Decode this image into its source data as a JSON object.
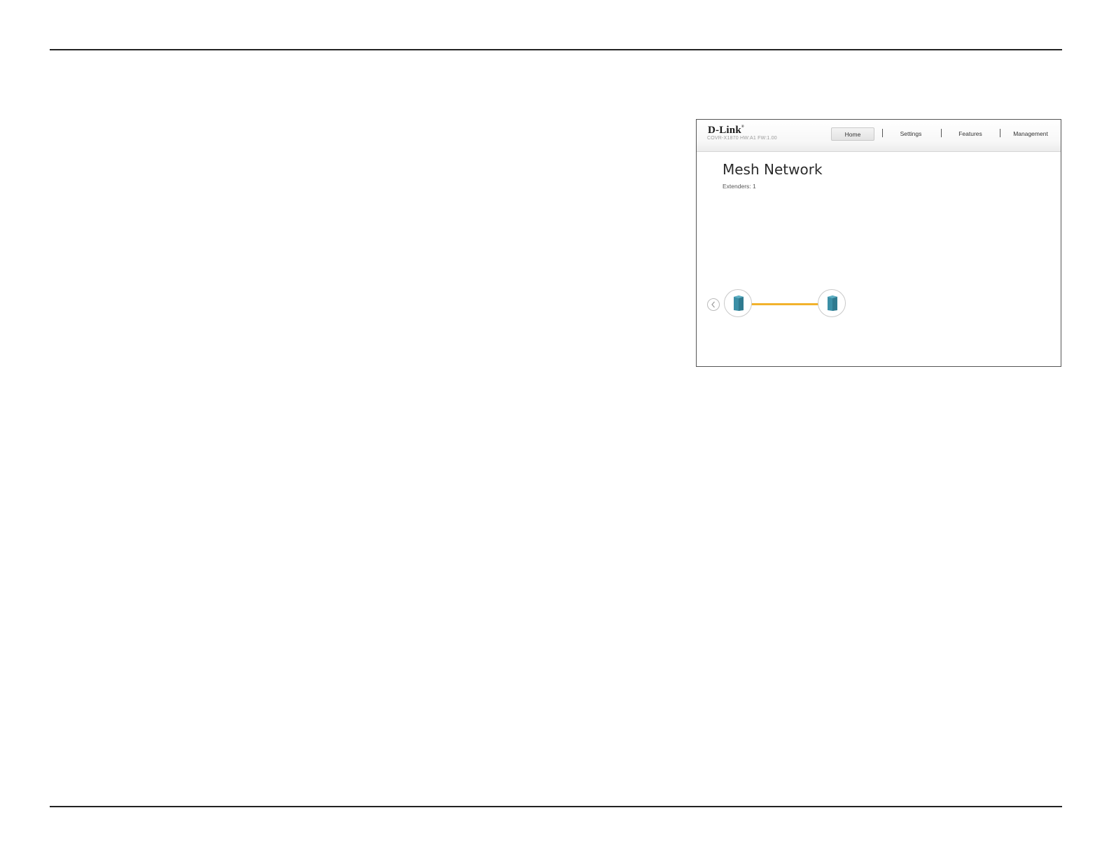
{
  "header": {
    "brand": "D-Link",
    "brand_mark": "®",
    "model": "COVR-X1870 HW:A1 FW:1.00"
  },
  "nav": {
    "items": [
      {
        "label": "Home",
        "active": true
      },
      {
        "label": "Settings",
        "active": false
      },
      {
        "label": "Features",
        "active": false
      },
      {
        "label": "Management",
        "active": false
      }
    ]
  },
  "main": {
    "title": "Mesh Network",
    "extenders": "Extenders: 1"
  },
  "topology": {
    "nodes": [
      {
        "icon": "router-icon"
      },
      {
        "icon": "extender-icon"
      }
    ],
    "link_color": "#f2b22c",
    "device_color": "#3b8fa6"
  },
  "icons": {
    "prev": "chevron-left-icon"
  }
}
